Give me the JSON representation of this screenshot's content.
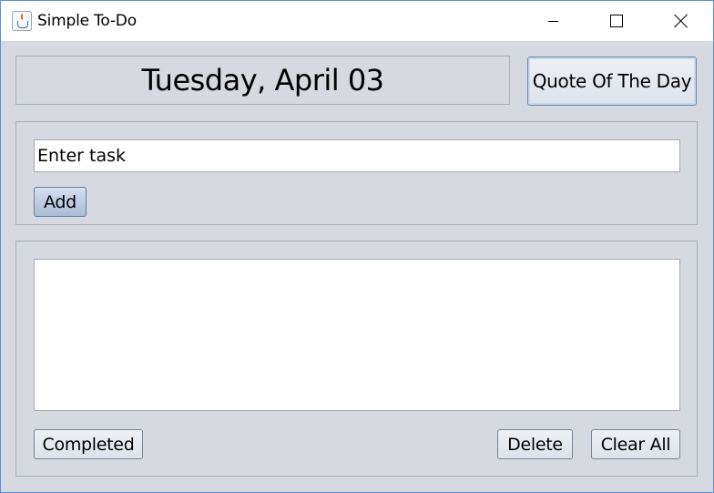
{
  "window": {
    "title": "Simple To-Do",
    "icon": "java-cup-icon",
    "controls": [
      "minimize",
      "maximize",
      "close"
    ]
  },
  "header": {
    "date": "Tuesday, April 03",
    "quote_button": "Quote Of The Day"
  },
  "task_entry": {
    "value": "Enter task",
    "add_button": "Add"
  },
  "task_list": {
    "items": []
  },
  "actions": {
    "completed": "Completed",
    "delete": "Delete",
    "clear_all": "Clear All"
  },
  "colors": {
    "window_background": "#d6d9df",
    "titlebar_background": "#ffffff",
    "window_border": "#5a8fd8",
    "add_button_accent": "#a9bdd6"
  }
}
